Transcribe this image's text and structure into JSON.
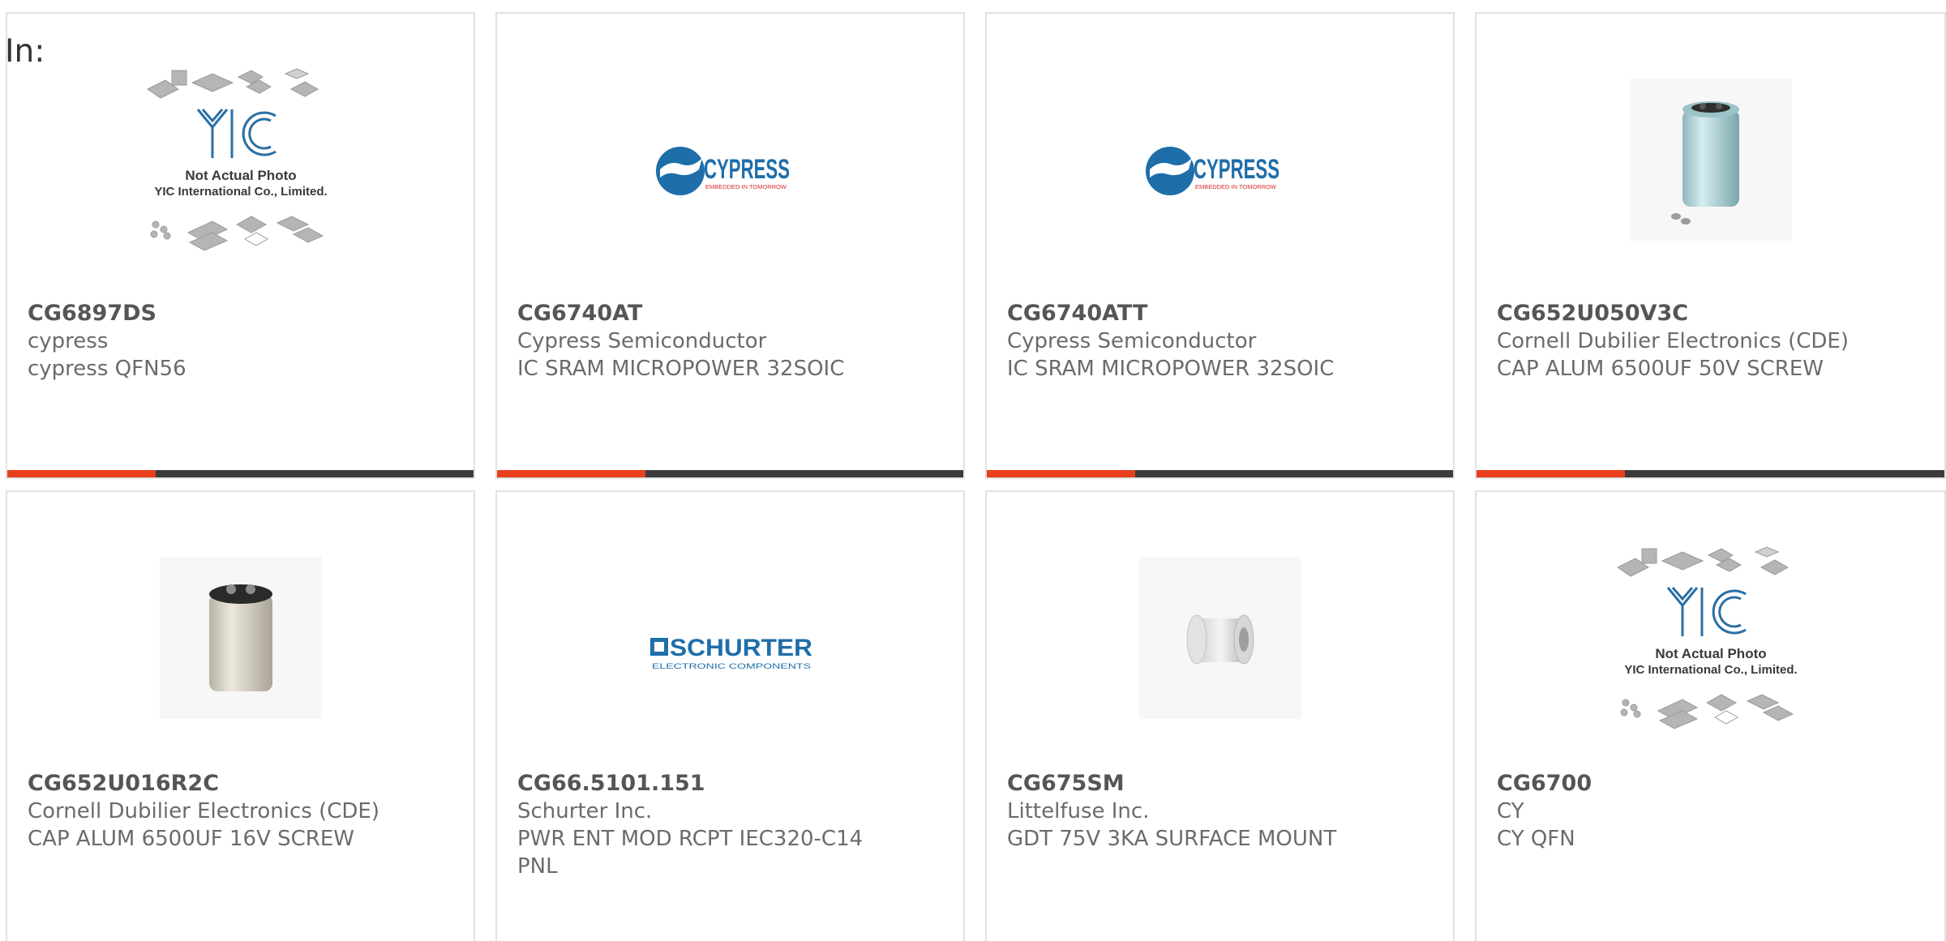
{
  "header": {
    "in_label": "In:"
  },
  "colors": {
    "accent": "#e8401c",
    "bar": "#3b3b3b",
    "border": "#e2e2e2",
    "cypress_blue": "#1e6ea9",
    "cypress_red": "#d62c2c"
  },
  "products": [
    {
      "part": "CG6897DS",
      "manufacturer": "cypress",
      "description": "cypress QFN56",
      "image": "yic-placeholder",
      "image_text": {
        "line1": "Not Actual Photo",
        "line2": "YIC International Co., Limited."
      }
    },
    {
      "part": "CG6740AT",
      "manufacturer": "Cypress Semiconductor",
      "description": "IC SRAM MICROPOWER 32SOIC",
      "image": "cypress-logo",
      "image_text": {
        "brand": "CYPRESS",
        "tagline": "EMBEDDED IN TOMORROW"
      }
    },
    {
      "part": "CG6740ATT",
      "manufacturer": "Cypress Semiconductor",
      "description": "IC SRAM MICROPOWER 32SOIC",
      "image": "cypress-logo",
      "image_text": {
        "brand": "CYPRESS",
        "tagline": "EMBEDDED IN TOMORROW"
      }
    },
    {
      "part": "CG652U050V3C",
      "manufacturer": "Cornell Dubilier Electronics (CDE)",
      "description": "CAP ALUM 6500UF 50V SCREW",
      "image": "capacitor-blue"
    },
    {
      "part": "CG652U016R2C",
      "manufacturer": "Cornell Dubilier Electronics (CDE)",
      "description": "CAP ALUM 6500UF 16V SCREW",
      "image": "capacitor-beige"
    },
    {
      "part": "CG66.5101.151",
      "manufacturer": "Schurter Inc.",
      "description": "PWR ENT MOD RCPT IEC320-C14 PNL",
      "image": "schurter-logo",
      "image_text": {
        "brand": "SCHURTER",
        "tagline": "ELECTRONIC COMPONENTS"
      }
    },
    {
      "part": "CG675SM",
      "manufacturer": "Littelfuse Inc.",
      "description": "GDT 75V 3KA SURFACE MOUNT",
      "image": "gdt-component"
    },
    {
      "part": "CG6700",
      "manufacturer": "CY",
      "description": "CY QFN",
      "image": "yic-placeholder",
      "image_text": {
        "line1": "Not Actual Photo",
        "line2": "YIC International Co., Limited."
      }
    }
  ]
}
